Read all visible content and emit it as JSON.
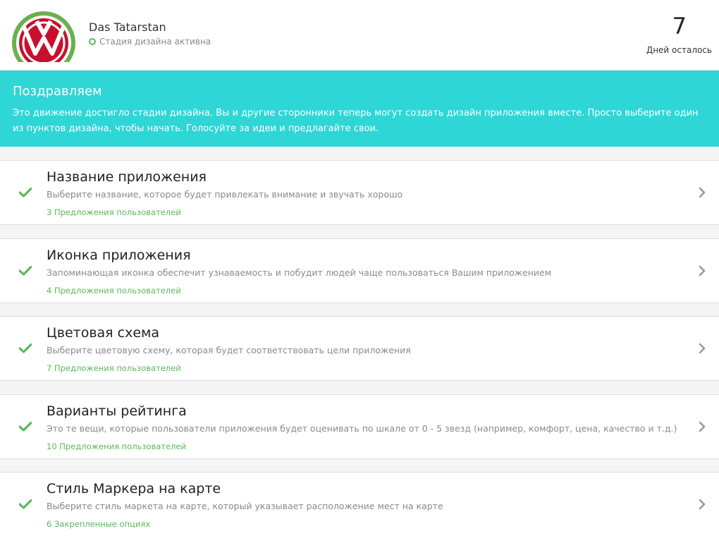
{
  "header": {
    "project_name": "Das Tatarstan",
    "status": "Стадия дизайна активна",
    "days_remaining": "7",
    "days_label": "Дней осталось"
  },
  "banner": {
    "title": "Поздравляем",
    "text": "Это движение достигло стадии дизайна. Вы и другие сторонники теперь могут создать дизайн приложения вместе. Просто выберите один из пунктов дизайна, чтобы начать. Голосуйте за идеи и предлагайте свои."
  },
  "items": [
    {
      "title": "Название приложения",
      "description": "Выберите название, которое будет привлекать внимание и звучать хорошо",
      "count": "3 Предложения пользователей"
    },
    {
      "title": "Иконка приложения",
      "description": "Запоминающая иконка обеспечит узнаваемость и побудит людей чаще пользоваться Вашим приложением",
      "count": "4 Предложения пользователей"
    },
    {
      "title": "Цветовая схема",
      "description": "Выберите цветовую схему, которая будет соответствовать цели приложения",
      "count": "7 Предложения пользователей"
    },
    {
      "title": "Варианты рейтинга",
      "description": "Это те вещи, которые пользователи приложения будет оценивать по шкале от 0 - 5 звезд (например, комфорт, цена, качество и т.д.)",
      "count": "10 Предложения пользователей"
    },
    {
      "title": "Стиль Маркера на карте",
      "description": "Выберите стиль маркета на карте, который указывает расположение мест на карте",
      "count": "6 Закрепленные опциях"
    }
  ],
  "colors": {
    "accent": "#2ed6d6",
    "success": "#5cb85c",
    "logo_red": "#c8102e",
    "logo_green": "#6ab04c"
  },
  "icons": {
    "logo": "volkswagen-logo",
    "status": "status-circle-icon",
    "item_done": "checkmark-icon",
    "item_open": "chevron-right-icon"
  }
}
